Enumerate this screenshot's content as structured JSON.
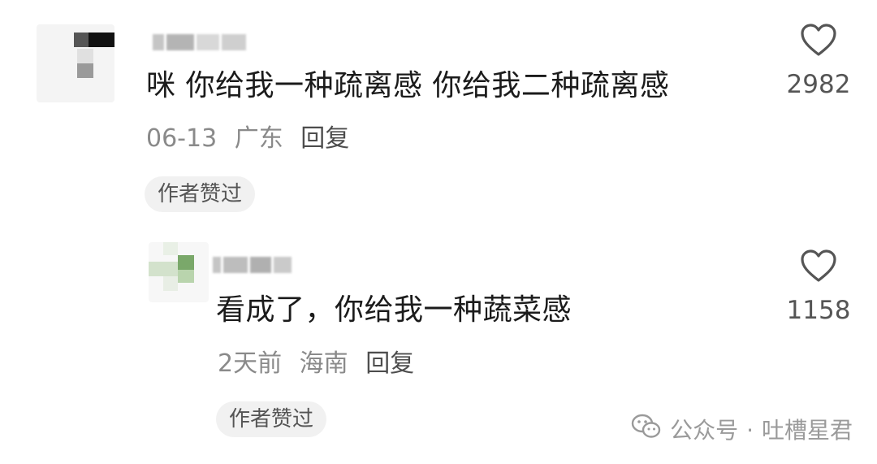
{
  "comments": [
    {
      "text": "咪 你给我一种疏离感 你给我二种疏离感",
      "date": "06-13",
      "location": "广东",
      "reply_label": "回复",
      "badge": "作者赞过",
      "likes": "2982",
      "avatar_icon": "blurred-avatar"
    },
    {
      "text": "看成了，你给我一种蔬菜感",
      "date": "2天前",
      "location": "海南",
      "reply_label": "回复",
      "badge": "作者赞过",
      "likes": "1158",
      "avatar_icon": "blurred-avatar"
    }
  ],
  "watermark": {
    "icon": "wechat-icon",
    "label": "公众号",
    "separator": "·",
    "account": "吐槽星君"
  }
}
